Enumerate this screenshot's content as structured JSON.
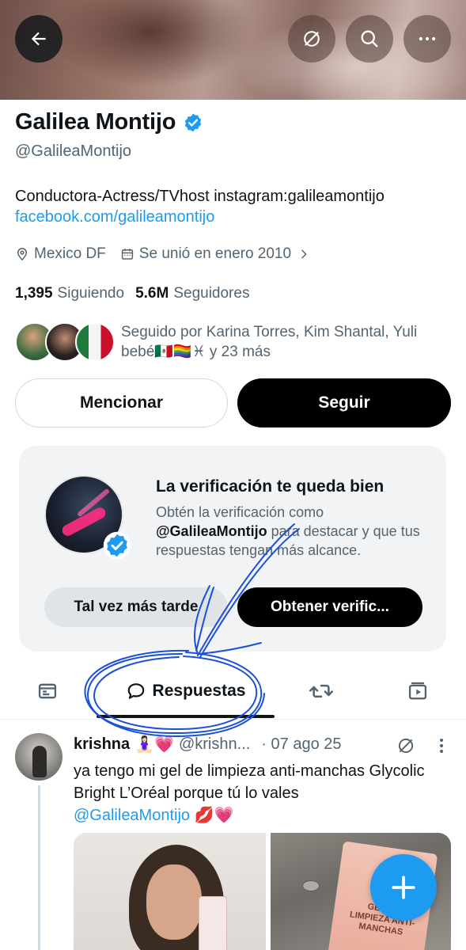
{
  "profile": {
    "name": "Galilea Montijo",
    "handle": "@GalileaMontijo",
    "bio_line1": "Conductora-Actress/TVhost instagram:galileamontijo",
    "bio_link": "facebook.com/galileamontijo",
    "location": "Mexico DF",
    "joined": "Se unió en enero 2010",
    "following_count": "1,395",
    "following_label": "Siguiendo",
    "followers_count": "5.6M",
    "followers_label": "Seguidores",
    "followed_by": "Seguido por Karina Torres, Kim Shantal, Yuli bebé🇲🇽🏳️‍🌈♓ y 23 más"
  },
  "actions": {
    "mention": "Mencionar",
    "follow": "Seguir"
  },
  "verification_card": {
    "title": "La verificación te queda bien",
    "body_prefix": "Obtén la verificación como",
    "body_handle": "@GalileaMontijo",
    "body_suffix": "para destacar y que tus respuestas tengan más alcance.",
    "later_button": "Tal vez más tarde",
    "get_button": "Obtener verific..."
  },
  "tabs": {
    "active_label": "Respuestas"
  },
  "post": {
    "author": "krishna",
    "author_emojis": "🧘🏻‍♀️💗",
    "handle": "@krishn...",
    "date": "· 07 ago 25",
    "text": "ya tengo mi gel de limpieza anti-manchas Glycolic Bright L’Oréal porque tú lo vales",
    "mention": "@GalileaMontijo",
    "trailing_emojis": "💋💗",
    "image2_label": "GEL DE LIMPIEZA ANTI-MANCHAS"
  },
  "icons": {
    "back": "arrow-left-icon",
    "grok": "grok-icon",
    "search": "search-icon",
    "more": "more-horizontal-icon",
    "verified": "verified-badge-icon",
    "location": "location-pin-icon",
    "calendar": "calendar-icon",
    "tab_posts": "posts-icon",
    "tab_replies": "speech-bubble-icon",
    "tab_reposts": "repost-icon",
    "tab_media": "media-icon",
    "compose": "plus-icon"
  },
  "colors": {
    "accent": "#1d9bf0",
    "annotation": "#1a4fd8",
    "text_primary": "#0f1419",
    "text_secondary": "#536471"
  }
}
